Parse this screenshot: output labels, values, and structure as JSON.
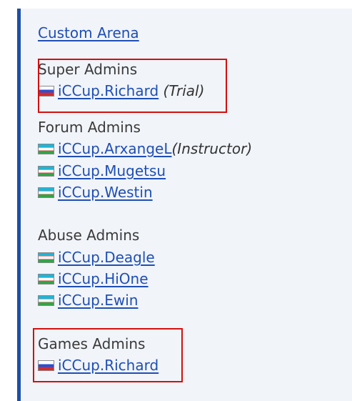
{
  "title_link": "Custom Arena",
  "groups": [
    {
      "heading": "Super Admins",
      "members": [
        {
          "name": "iCCup.Richard",
          "note": "(Trial)",
          "flag": "flag-ru-icon"
        }
      ]
    },
    {
      "heading": "Forum Admins",
      "members": [
        {
          "name": "iCCup.ArxangeL",
          "note": "(Instructor)",
          "flag": "flag-uz-icon"
        },
        {
          "name": "iCCup.Mugetsu",
          "note": "",
          "flag": "flag-uz-icon"
        },
        {
          "name": "iCCup.Westin",
          "note": "",
          "flag": "flag-uz-icon"
        }
      ]
    },
    {
      "heading": "Abuse Admins",
      "members": [
        {
          "name": "iCCup.Deagle",
          "note": "",
          "flag": "flag-uz-icon"
        },
        {
          "name": "iCCup.HiOne",
          "note": "",
          "flag": "flag-uz-icon"
        },
        {
          "name": "iCCup.Ewin",
          "note": "",
          "flag": "flag-uz-icon"
        }
      ]
    },
    {
      "heading": "Games Admins",
      "members": [
        {
          "name": "iCCup.Richard",
          "note": "",
          "flag": "flag-ru-icon"
        }
      ]
    }
  ],
  "colors": {
    "link": "#1f4fb5",
    "accent_border": "#1d4fa8",
    "highlight_box": "#d21010",
    "panel_bg": "#f1f4f9"
  }
}
